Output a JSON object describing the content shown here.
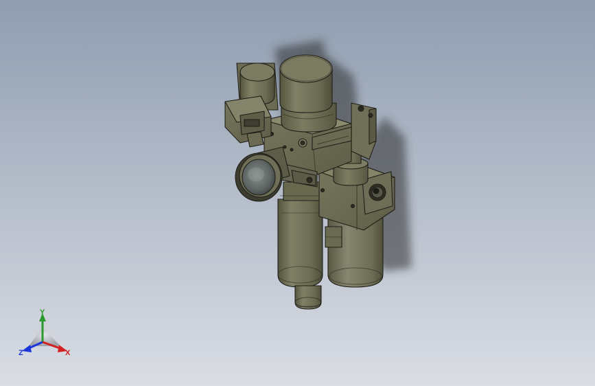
{
  "viewport": {
    "background_top": "#8f9db0",
    "background_bottom": "#d9dde4",
    "model_color": "#6f6f57"
  },
  "triad": {
    "x_label": "X",
    "y_label": "Y",
    "z_label": "Z",
    "x_color": "#d42020",
    "y_color": "#2a9a2a",
    "z_color": "#1a36d8"
  }
}
